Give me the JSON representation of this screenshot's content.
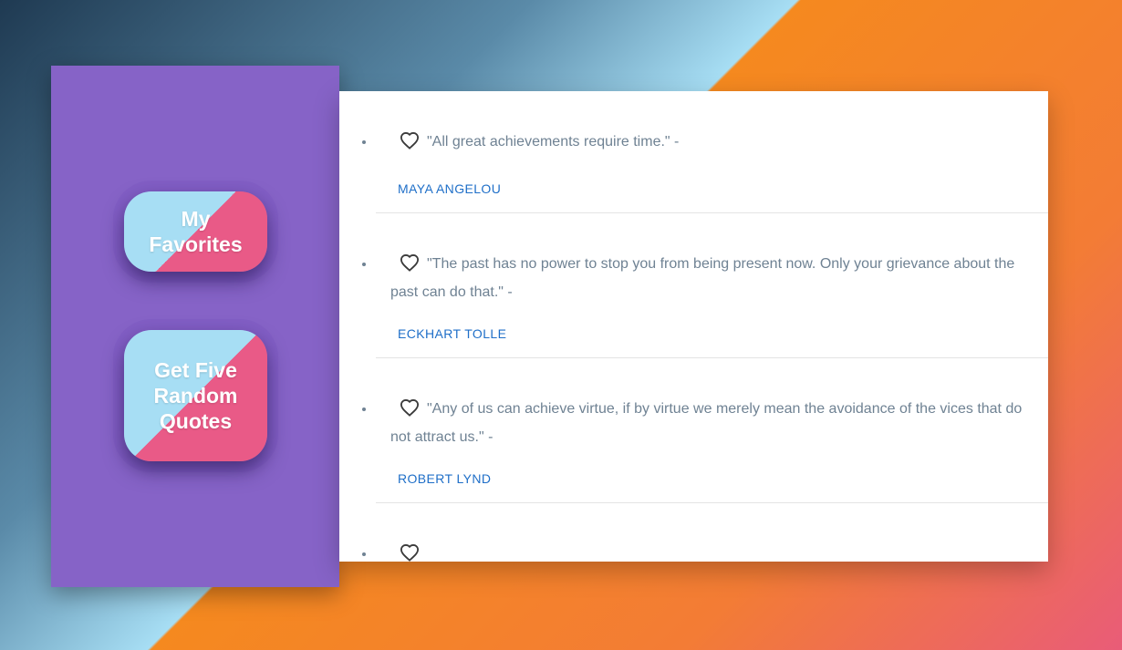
{
  "sidebar": {
    "favorites_label": "My Favorites",
    "random_label": "Get Five Random Quotes"
  },
  "quotes": [
    {
      "text": "\"All great achievements require time.\" -",
      "author": "MAYA ANGELOU",
      "icon": "heart-outline-icon"
    },
    {
      "text": "\"The past has no power to stop you from being present now. Only your grievance about the past can do that.\" -",
      "author": "ECKHART TOLLE",
      "icon": "heart-outline-icon"
    },
    {
      "text": "\"Any of us can achieve virtue, if by virtue we merely mean the avoidance of the vices that do not attract us.\" -",
      "author": "ROBERT LYND",
      "icon": "heart-outline-icon"
    },
    {
      "text": "",
      "author": "",
      "icon": "heart-outline-icon"
    }
  ],
  "colors": {
    "sidebar_bg": "#8663c7",
    "button_light": "#a7def4",
    "button_pink": "#e95a87",
    "author_link": "#1f6fc8",
    "quote_text": "#6f8293"
  }
}
